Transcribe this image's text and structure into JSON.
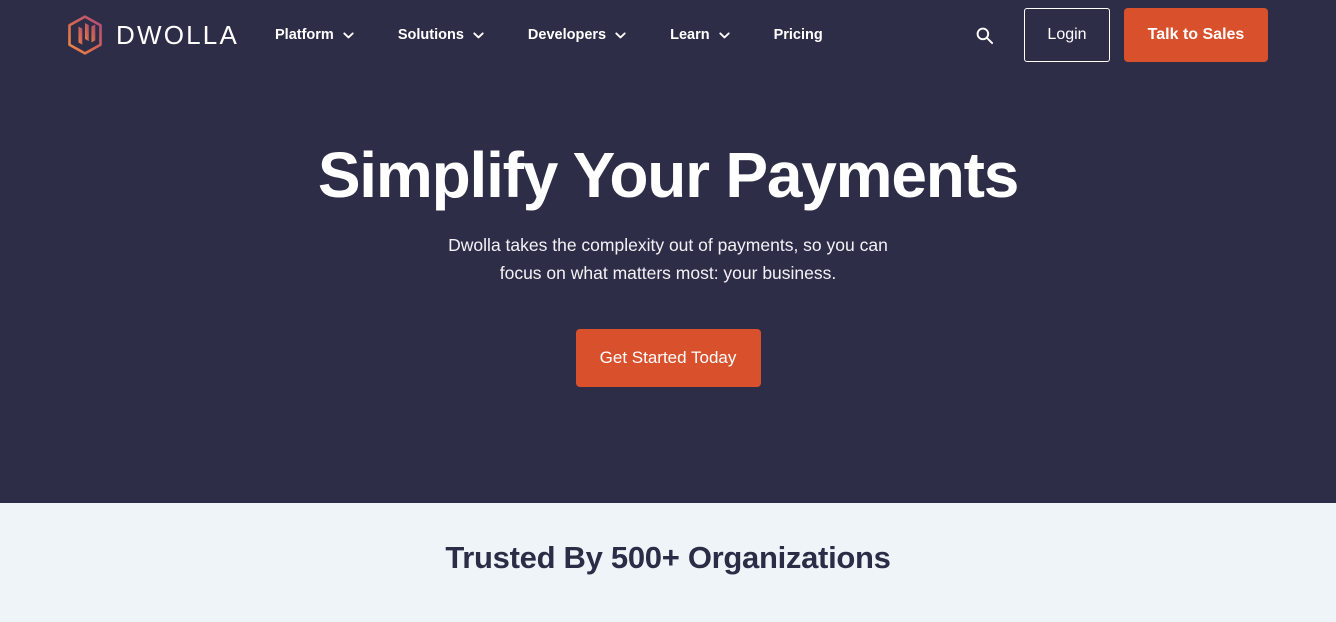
{
  "theme": {
    "hero_bg": "#2e2d48",
    "light_bg": "#eff4f9",
    "accent_orange": "#d9512c",
    "text_light": "#ffffff",
    "text_dark": "#2b2d47",
    "logo_gradient_from": "#e8804a",
    "logo_gradient_to": "#b84a7d"
  },
  "header": {
    "brand": {
      "icon": "dwolla-hexagon-logo-icon",
      "wordmark": "DWOLLA"
    },
    "nav_items": [
      {
        "label": "Platform",
        "has_dropdown": true,
        "icon": "chevron-down-icon"
      },
      {
        "label": "Solutions",
        "has_dropdown": true,
        "icon": "chevron-down-icon"
      },
      {
        "label": "Developers",
        "has_dropdown": true,
        "icon": "chevron-down-icon"
      },
      {
        "label": "Learn",
        "has_dropdown": true,
        "icon": "chevron-down-icon"
      },
      {
        "label": "Pricing",
        "has_dropdown": false,
        "icon": ""
      }
    ],
    "search": {
      "icon": "search-icon",
      "aria_label": "Search"
    },
    "login_label": "Login",
    "sales_label": "Talk to Sales"
  },
  "hero": {
    "title": "Simplify Your Payments",
    "subtitle_line1": "Dwolla takes the complexity out of payments, so you can",
    "subtitle_line2": "focus on what matters most: your business.",
    "cta_label": "Get Started Today"
  },
  "trusted": {
    "title": "Trusted By 500+ Organizations"
  }
}
